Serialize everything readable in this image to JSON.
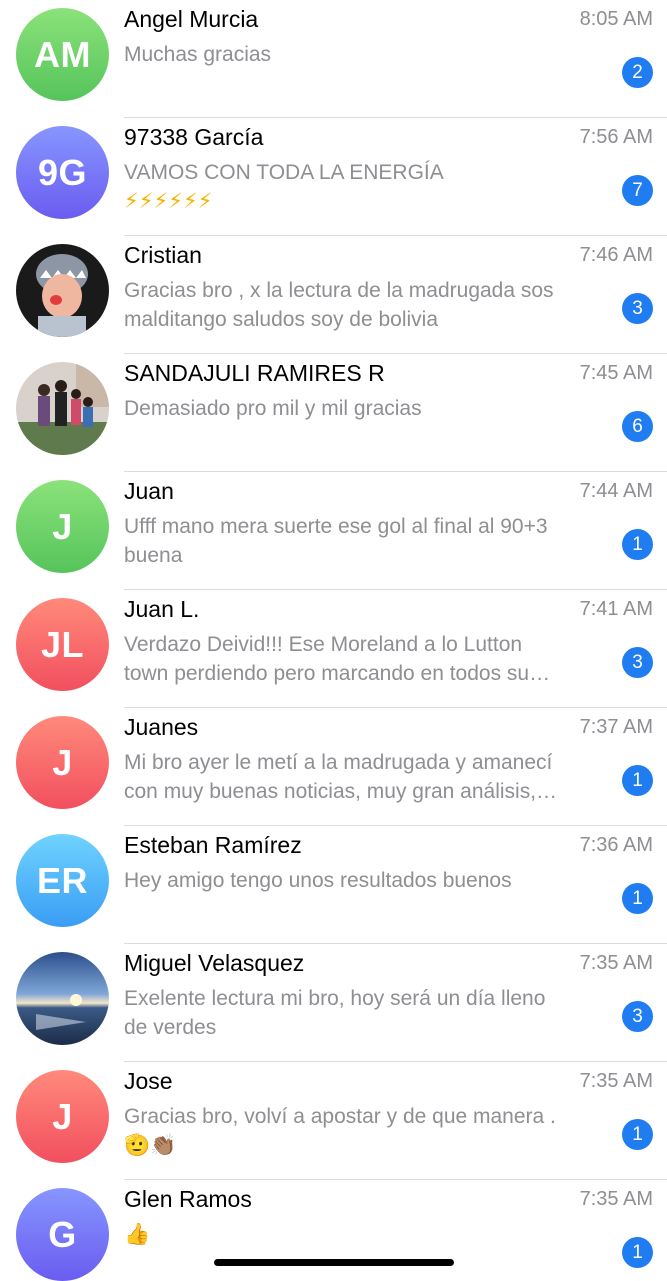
{
  "chats": [
    {
      "name": "Angel Murcia",
      "initials": "AM",
      "time": "8:05 AM",
      "line1": "Muchas gracias",
      "line2": "",
      "badge": "2",
      "avatar_color": "#5ec85c"
    },
    {
      "name": "97338 García",
      "initials": "9G",
      "time": "7:56 AM",
      "line1": "VAMOS CON TODA LA ENERGÍA",
      "line2": "⚡⚡⚡⚡⚡⚡",
      "badge": "7",
      "avatar_color": "#6d63f3"
    },
    {
      "name": "Cristian",
      "initials": "",
      "time": "7:46 AM",
      "line1": "Gracias bro , x la lectura de la madrugada sos",
      "line2": "malditango saludos soy de bolivia",
      "badge": "3",
      "avatar_color": "#2a2a2a"
    },
    {
      "name": "SANDAJULI RAMIRES R",
      "initials": "",
      "time": "7:45 AM",
      "line1": "Demasiado pro mil y mil gracias",
      "line2": "",
      "badge": "6",
      "avatar_color": "#8a9a86"
    },
    {
      "name": "Juan",
      "initials": "J",
      "time": "7:44 AM",
      "line1": "Ufff mano mera suerte ese gol al final al 90+3",
      "line2": "buena",
      "badge": "1",
      "avatar_color": "#5ec85c"
    },
    {
      "name": "Juan L.",
      "initials": "JL",
      "time": "7:41 AM",
      "line1": "Verdazo Deivid!!! Ese Moreland a lo Lutton",
      "line2": "town perdiendo pero marcando en todos su…",
      "badge": "3",
      "avatar_color": "#f2545f"
    },
    {
      "name": "Juanes",
      "initials": "J",
      "time": "7:37 AM",
      "line1": "Mi bro ayer le metí a la madrugada y amanecí",
      "line2": "con muy buenas noticias, muy gran análisis,…",
      "badge": "1",
      "avatar_color": "#f2545f"
    },
    {
      "name": "Esteban Ramírez",
      "initials": "ER",
      "time": "7:36 AM",
      "line1": "Hey amigo tengo unos resultados buenos",
      "line2": "",
      "badge": "1",
      "avatar_color": "#3a9df4"
    },
    {
      "name": "Miguel Velasquez",
      "initials": "",
      "time": "7:35 AM",
      "line1": "Exelente lectura mi bro, hoy será un día lleno",
      "line2": "de verdes",
      "badge": "3",
      "avatar_color": "#3b5a8c"
    },
    {
      "name": "Jose",
      "initials": "J",
      "time": "7:35 AM",
      "line1": "Gracias bro, volví a apostar y de que manera .",
      "line2": "🫡👏🏽",
      "badge": "1",
      "avatar_color": "#f2545f"
    },
    {
      "name": "Glen Ramos",
      "initials": "G",
      "time": "7:35 AM",
      "line1": "👍",
      "line2": "",
      "badge": "1",
      "avatar_color": "#6d63f3"
    }
  ],
  "colors": {
    "badge": "#1f7cf1",
    "secondary_text": "#8e8e93",
    "divider": "#dcdce0"
  }
}
